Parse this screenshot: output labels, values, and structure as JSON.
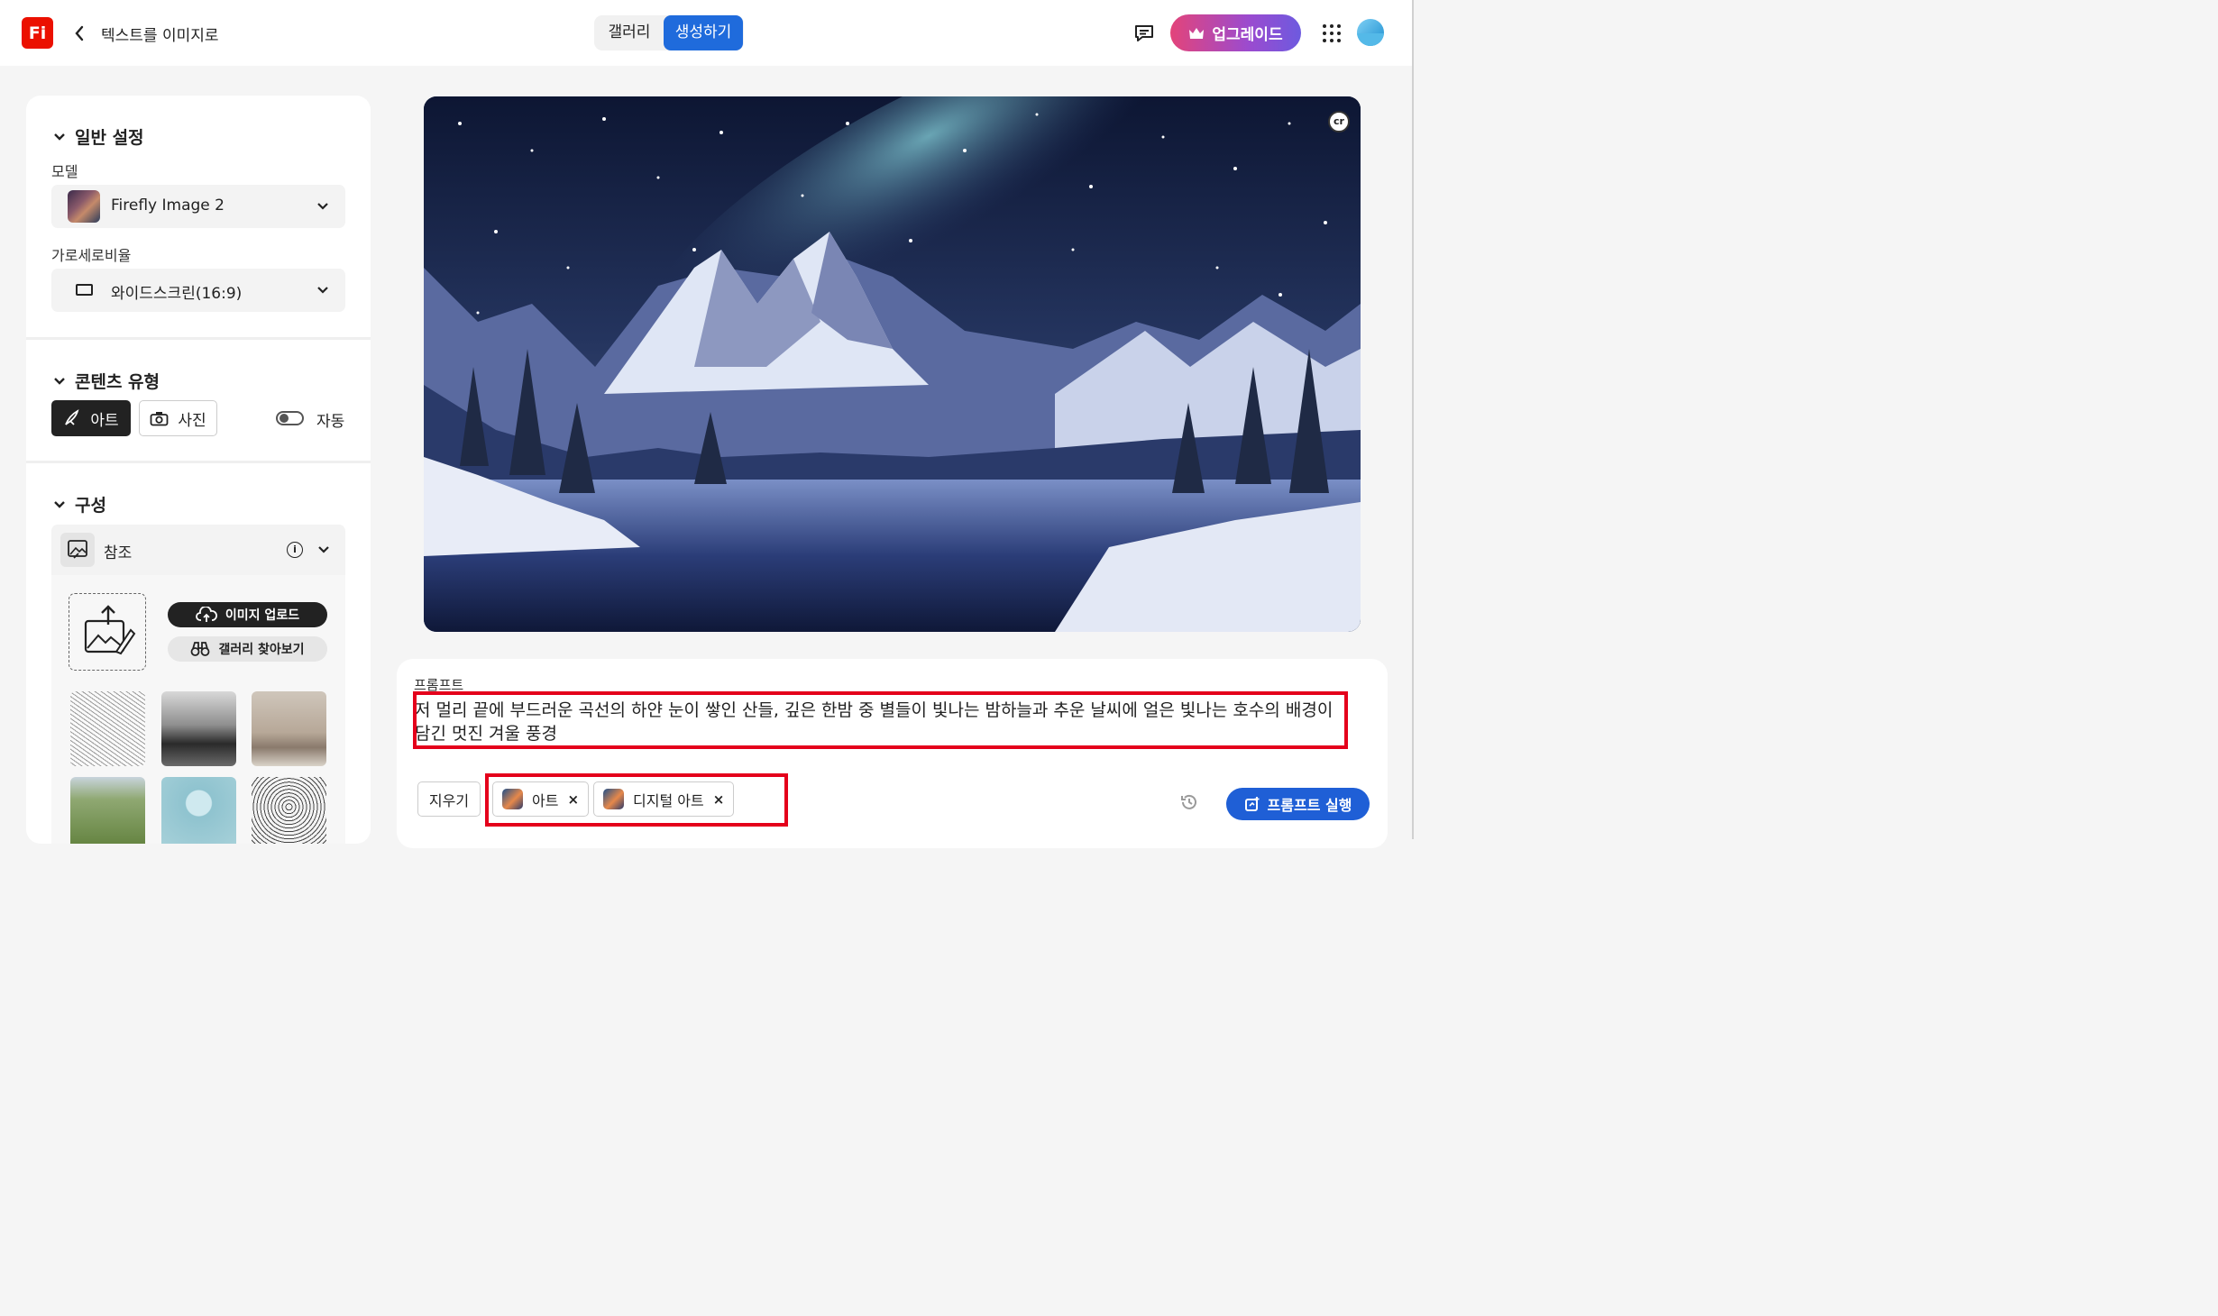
{
  "app": {
    "logo_text": "Fi",
    "page_title": "텍스트를 이미지로",
    "tabs": {
      "gallery": "갤러리",
      "generate": "생성하기"
    },
    "upgrade_label": "업그레이드"
  },
  "sidebar": {
    "general": {
      "title": "일반 설정",
      "model_label": "모델",
      "model_value": "Firefly Image 2",
      "ratio_label": "가로세로비율",
      "ratio_value": "와이드스크린(16:9)"
    },
    "content_type": {
      "title": "콘텐츠 유형",
      "art_label": "아트",
      "photo_label": "사진",
      "auto_label": "자동",
      "selected": "아트"
    },
    "composition": {
      "title": "구성",
      "reference_label": "참조",
      "upload_label": "이미지 업로드",
      "browse_label": "갤러리 찾아보기"
    }
  },
  "image": {
    "badge": "cr"
  },
  "prompt": {
    "label": "프롬프트",
    "text": "저 멀리 끝에 부드러운 곡선의 하얀 눈이 쌓인 산들, 깊은 한밤 중 별들이 빛나는 밤하늘과 추운 날씨에 얼은 빛나는 호수의 배경이 담긴 멋진 겨울 풍경",
    "clear_label": "지우기",
    "chips": [
      "아트",
      "디지털 아트"
    ],
    "run_label": "프롬프트 실행"
  },
  "colors": {
    "accent": "#1f6bdc",
    "logo": "#eb1000",
    "highlight": "#e4001b"
  }
}
